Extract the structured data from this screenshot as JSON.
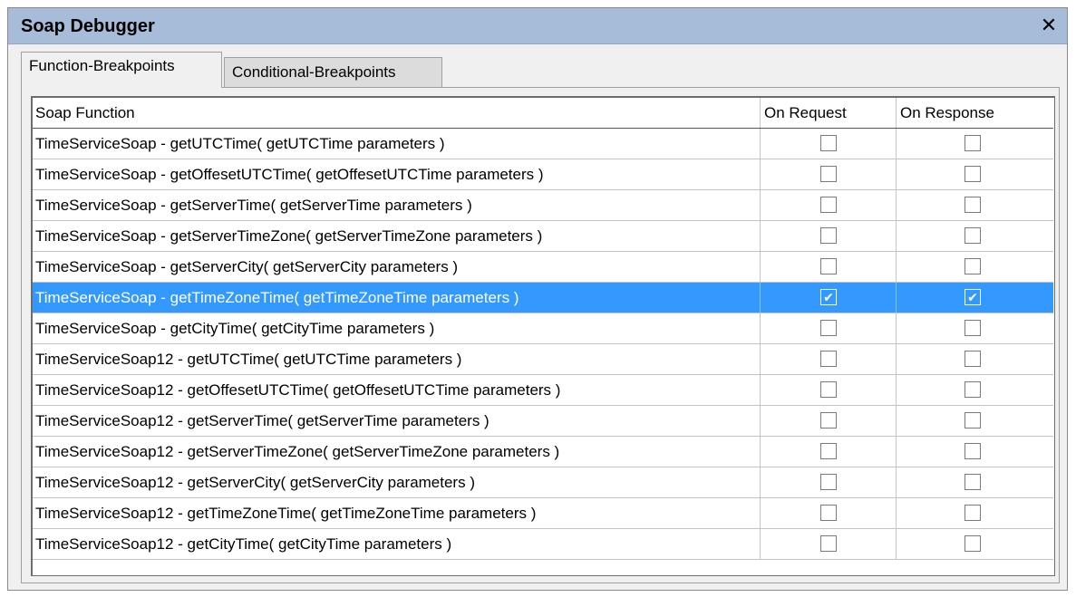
{
  "window": {
    "title": "Soap Debugger",
    "close_glyph": "✕"
  },
  "tabs": [
    {
      "label": "Function-Breakpoints",
      "active": true
    },
    {
      "label": "Conditional-Breakpoints",
      "active": false
    }
  ],
  "table": {
    "columns": [
      "Soap Function",
      "On Request",
      "On Response"
    ],
    "rows": [
      {
        "function": "TimeServiceSoap - getUTCTime( getUTCTime parameters )",
        "on_request": false,
        "on_response": false,
        "selected": false
      },
      {
        "function": "TimeServiceSoap - getOffesetUTCTime( getOffesetUTCTime parameters )",
        "on_request": false,
        "on_response": false,
        "selected": false
      },
      {
        "function": "TimeServiceSoap - getServerTime( getServerTime parameters )",
        "on_request": false,
        "on_response": false,
        "selected": false
      },
      {
        "function": "TimeServiceSoap - getServerTimeZone( getServerTimeZone parameters )",
        "on_request": false,
        "on_response": false,
        "selected": false
      },
      {
        "function": "TimeServiceSoap - getServerCity( getServerCity parameters )",
        "on_request": false,
        "on_response": false,
        "selected": false
      },
      {
        "function": "TimeServiceSoap - getTimeZoneTime( getTimeZoneTime parameters )",
        "on_request": true,
        "on_response": true,
        "selected": true
      },
      {
        "function": "TimeServiceSoap - getCityTime( getCityTime parameters )",
        "on_request": false,
        "on_response": false,
        "selected": false
      },
      {
        "function": "TimeServiceSoap12 - getUTCTime( getUTCTime parameters )",
        "on_request": false,
        "on_response": false,
        "selected": false
      },
      {
        "function": "TimeServiceSoap12 - getOffesetUTCTime( getOffesetUTCTime parameters )",
        "on_request": false,
        "on_response": false,
        "selected": false
      },
      {
        "function": "TimeServiceSoap12 - getServerTime( getServerTime parameters )",
        "on_request": false,
        "on_response": false,
        "selected": false
      },
      {
        "function": "TimeServiceSoap12 - getServerTimeZone( getServerTimeZone parameters )",
        "on_request": false,
        "on_response": false,
        "selected": false
      },
      {
        "function": "TimeServiceSoap12 - getServerCity( getServerCity parameters )",
        "on_request": false,
        "on_response": false,
        "selected": false
      },
      {
        "function": "TimeServiceSoap12 - getTimeZoneTime( getTimeZoneTime parameters )",
        "on_request": false,
        "on_response": false,
        "selected": false
      },
      {
        "function": "TimeServiceSoap12 - getCityTime( getCityTime parameters )",
        "on_request": false,
        "on_response": false,
        "selected": false
      }
    ]
  },
  "colors": {
    "titlebar": "#a7bcd8",
    "selection": "#3399ff",
    "panel": "#f0f0f0"
  },
  "icons": {
    "close": "close-icon",
    "check": "checkmark-icon"
  }
}
